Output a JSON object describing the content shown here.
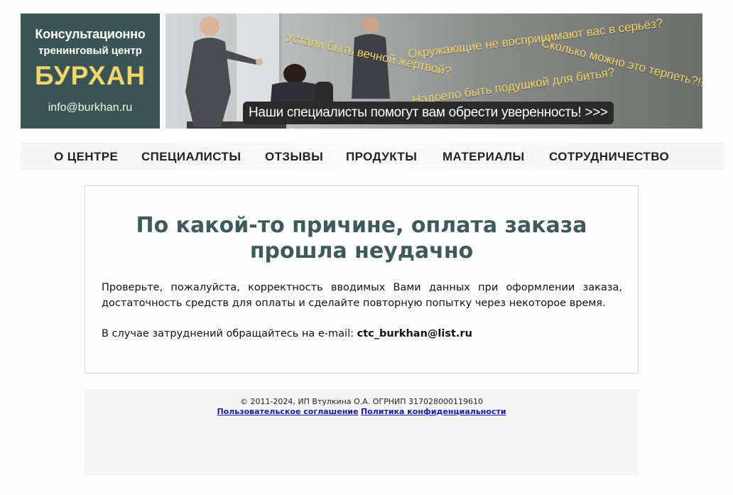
{
  "logo": {
    "line1": "Консультационно",
    "line2": "тренинговый центр",
    "name": "БУРХАН",
    "email": "info@burkhan.ru"
  },
  "banner": {
    "quotes": [
      "Устали быть вечной жертвой?",
      "Окружающие не воспринимают вас в серьёз?",
      "Сколько можно это терпеть?!!",
      "Надоело быть подушкой для битья?"
    ],
    "cta": "Наши специалисты  помогут вам обрести уверенность!  >>>"
  },
  "nav": {
    "items": [
      "О ЦЕНТРЕ",
      "СПЕЦИАЛИСТЫ",
      "ОТЗЫВЫ",
      "ПРОДУКТЫ",
      "МАТЕРИАЛЫ",
      "СОТРУДНИЧЕСТВО"
    ]
  },
  "main": {
    "title": "По какой-то причине, оплата заказа прошла неудачно",
    "paragraph1": "Проверьте, пожалуйста, корректность вводимых Вами данных при оформлении заказа, достаточность средств для оплаты и сделайте повторную попытку через некоторое время.",
    "paragraph2_prefix": "В случае затруднений обращайтесь на e-mail: ",
    "contact_email": "ctc_burkhan@list.ru"
  },
  "footer": {
    "copyright": "© 2011-2024, ИП Втулкина О.А. ОГРНИП 317028000119610",
    "link_agreement": "Пользовательское соглашение",
    "link_privacy": "Политика конфиденциальности"
  },
  "colors": {
    "logo_bg": "#3a5555",
    "logo_name": "#f1d76b",
    "heading": "#3e5a5c",
    "link": "#1a1aa8"
  }
}
